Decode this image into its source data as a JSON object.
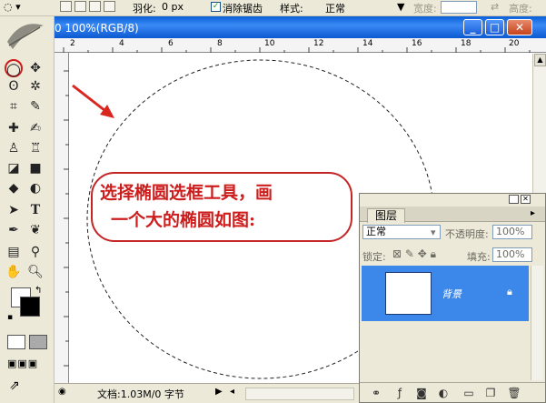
{
  "options_bar": {
    "feather_label": "羽化:",
    "feather_value": "0 px",
    "antialias_label": "消除锯齿",
    "style_label": "样式:",
    "style_value": "正常",
    "width_label": "宽度:",
    "height_label": "高度:"
  },
  "document": {
    "title": "0 100%(RGB/8)",
    "ruler_ticks": [
      "2",
      "4",
      "6",
      "8",
      "10",
      "12",
      "14",
      "16",
      "18",
      "20"
    ],
    "status_doc": "文档:1.03M/0 字节"
  },
  "callout": {
    "line1": "选择椭圆选框工具，画",
    "line2": "一个大的椭圆如图:"
  },
  "layers_panel": {
    "tab_label": "图层",
    "blend_mode": "正常",
    "opacity_label": "不透明度:",
    "opacity_value": "100%",
    "lock_label": "锁定:",
    "fill_label": "填充:",
    "fill_value": "100%",
    "layer_name": "背景"
  },
  "colors": {
    "accent": "#3b87ea",
    "title_bar": "#0a5fd8",
    "callout_red": "#cd1d1d"
  }
}
